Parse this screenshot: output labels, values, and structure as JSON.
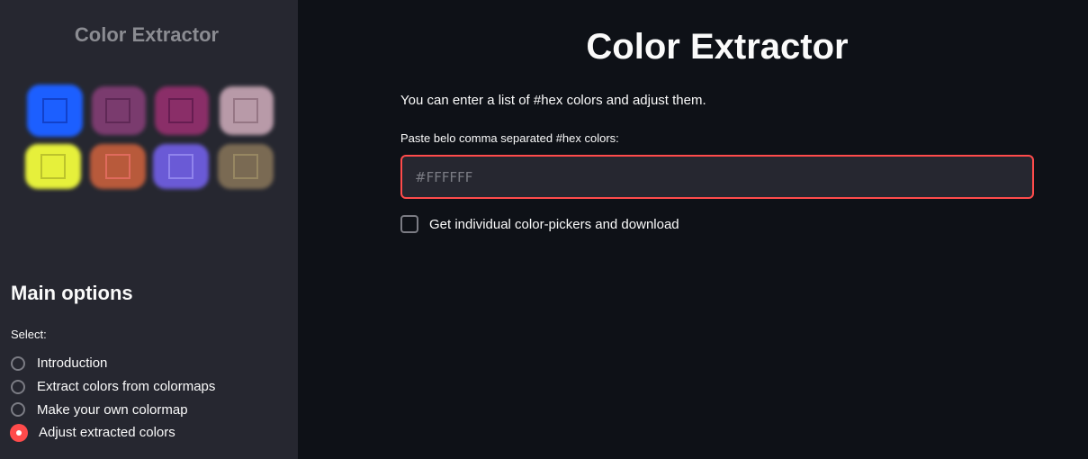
{
  "sidebar": {
    "title": "Color Extractor",
    "logo_icon": "paint-swatches-logo",
    "options_heading": "Main options",
    "select_label": "Select:",
    "radio_options": [
      {
        "label": "Introduction",
        "checked": false
      },
      {
        "label": "Extract colors from colormaps",
        "checked": false
      },
      {
        "label": "Make your own colormap",
        "checked": false
      },
      {
        "label": "Adjust extracted colors",
        "checked": true
      }
    ]
  },
  "main": {
    "title": "Color Extractor",
    "intro": "You can enter a list of #hex colors and adjust them.",
    "input_label": "Paste belo comma separated #hex colors:",
    "input_placeholder": "#FFFFFF",
    "input_value": "",
    "checkbox_label": "Get individual color-pickers and download",
    "checkbox_checked": false
  },
  "colors": {
    "accent": "#ff4b4b",
    "sidebar_bg": "#262730",
    "main_bg": "#0e1117",
    "swatches": [
      "#1e5eff",
      "#7a3a6e",
      "#8a2f68",
      "#b89aa8",
      "#e6f03a",
      "#b85a3a",
      "#6a5ad6",
      "#7a6a52"
    ]
  }
}
